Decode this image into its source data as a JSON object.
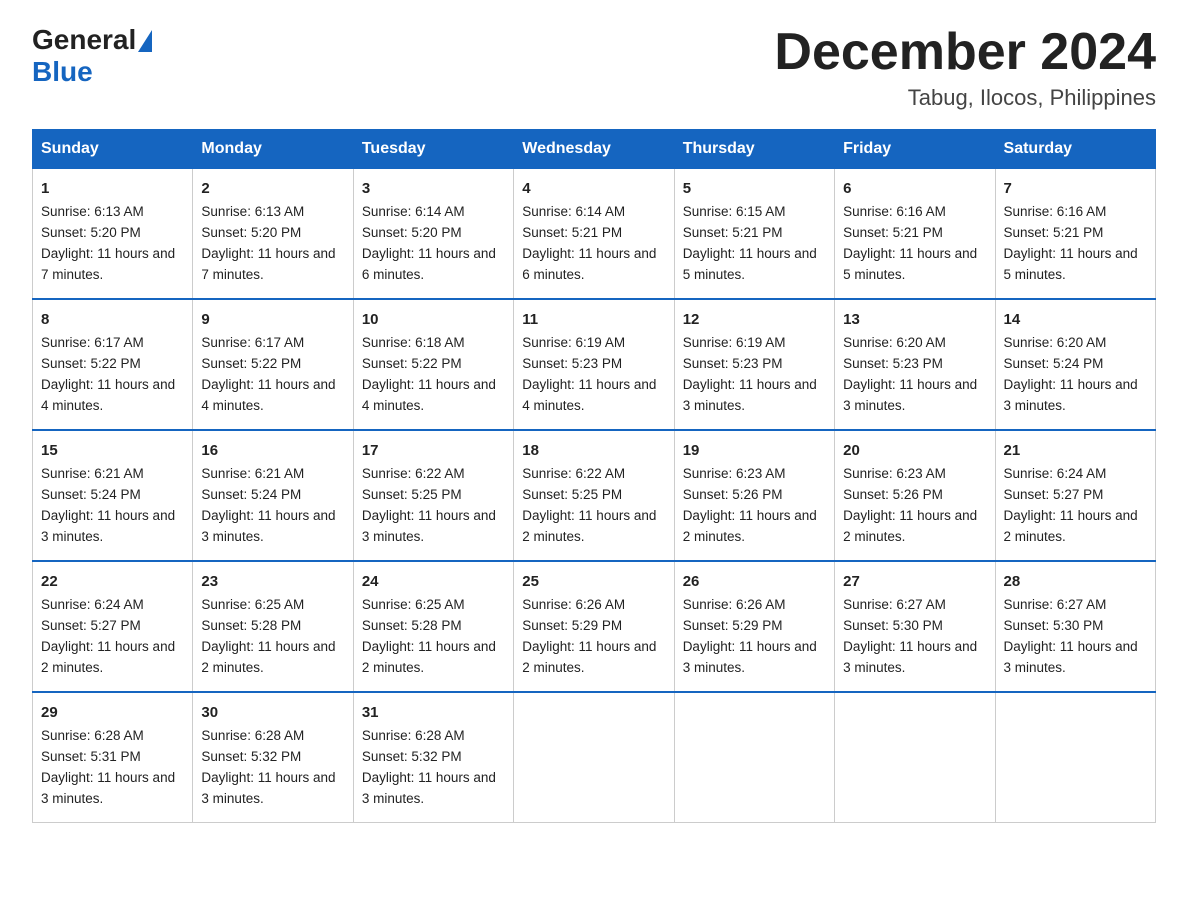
{
  "logo": {
    "general": "General",
    "blue": "Blue"
  },
  "title": "December 2024",
  "subtitle": "Tabug, Ilocos, Philippines",
  "days": [
    "Sunday",
    "Monday",
    "Tuesday",
    "Wednesday",
    "Thursday",
    "Friday",
    "Saturday"
  ],
  "weeks": [
    [
      {
        "num": "1",
        "sunrise": "6:13 AM",
        "sunset": "5:20 PM",
        "daylight": "11 hours and 7 minutes."
      },
      {
        "num": "2",
        "sunrise": "6:13 AM",
        "sunset": "5:20 PM",
        "daylight": "11 hours and 7 minutes."
      },
      {
        "num": "3",
        "sunrise": "6:14 AM",
        "sunset": "5:20 PM",
        "daylight": "11 hours and 6 minutes."
      },
      {
        "num": "4",
        "sunrise": "6:14 AM",
        "sunset": "5:21 PM",
        "daylight": "11 hours and 6 minutes."
      },
      {
        "num": "5",
        "sunrise": "6:15 AM",
        "sunset": "5:21 PM",
        "daylight": "11 hours and 5 minutes."
      },
      {
        "num": "6",
        "sunrise": "6:16 AM",
        "sunset": "5:21 PM",
        "daylight": "11 hours and 5 minutes."
      },
      {
        "num": "7",
        "sunrise": "6:16 AM",
        "sunset": "5:21 PM",
        "daylight": "11 hours and 5 minutes."
      }
    ],
    [
      {
        "num": "8",
        "sunrise": "6:17 AM",
        "sunset": "5:22 PM",
        "daylight": "11 hours and 4 minutes."
      },
      {
        "num": "9",
        "sunrise": "6:17 AM",
        "sunset": "5:22 PM",
        "daylight": "11 hours and 4 minutes."
      },
      {
        "num": "10",
        "sunrise": "6:18 AM",
        "sunset": "5:22 PM",
        "daylight": "11 hours and 4 minutes."
      },
      {
        "num": "11",
        "sunrise": "6:19 AM",
        "sunset": "5:23 PM",
        "daylight": "11 hours and 4 minutes."
      },
      {
        "num": "12",
        "sunrise": "6:19 AM",
        "sunset": "5:23 PM",
        "daylight": "11 hours and 3 minutes."
      },
      {
        "num": "13",
        "sunrise": "6:20 AM",
        "sunset": "5:23 PM",
        "daylight": "11 hours and 3 minutes."
      },
      {
        "num": "14",
        "sunrise": "6:20 AM",
        "sunset": "5:24 PM",
        "daylight": "11 hours and 3 minutes."
      }
    ],
    [
      {
        "num": "15",
        "sunrise": "6:21 AM",
        "sunset": "5:24 PM",
        "daylight": "11 hours and 3 minutes."
      },
      {
        "num": "16",
        "sunrise": "6:21 AM",
        "sunset": "5:24 PM",
        "daylight": "11 hours and 3 minutes."
      },
      {
        "num": "17",
        "sunrise": "6:22 AM",
        "sunset": "5:25 PM",
        "daylight": "11 hours and 3 minutes."
      },
      {
        "num": "18",
        "sunrise": "6:22 AM",
        "sunset": "5:25 PM",
        "daylight": "11 hours and 2 minutes."
      },
      {
        "num": "19",
        "sunrise": "6:23 AM",
        "sunset": "5:26 PM",
        "daylight": "11 hours and 2 minutes."
      },
      {
        "num": "20",
        "sunrise": "6:23 AM",
        "sunset": "5:26 PM",
        "daylight": "11 hours and 2 minutes."
      },
      {
        "num": "21",
        "sunrise": "6:24 AM",
        "sunset": "5:27 PM",
        "daylight": "11 hours and 2 minutes."
      }
    ],
    [
      {
        "num": "22",
        "sunrise": "6:24 AM",
        "sunset": "5:27 PM",
        "daylight": "11 hours and 2 minutes."
      },
      {
        "num": "23",
        "sunrise": "6:25 AM",
        "sunset": "5:28 PM",
        "daylight": "11 hours and 2 minutes."
      },
      {
        "num": "24",
        "sunrise": "6:25 AM",
        "sunset": "5:28 PM",
        "daylight": "11 hours and 2 minutes."
      },
      {
        "num": "25",
        "sunrise": "6:26 AM",
        "sunset": "5:29 PM",
        "daylight": "11 hours and 2 minutes."
      },
      {
        "num": "26",
        "sunrise": "6:26 AM",
        "sunset": "5:29 PM",
        "daylight": "11 hours and 3 minutes."
      },
      {
        "num": "27",
        "sunrise": "6:27 AM",
        "sunset": "5:30 PM",
        "daylight": "11 hours and 3 minutes."
      },
      {
        "num": "28",
        "sunrise": "6:27 AM",
        "sunset": "5:30 PM",
        "daylight": "11 hours and 3 minutes."
      }
    ],
    [
      {
        "num": "29",
        "sunrise": "6:28 AM",
        "sunset": "5:31 PM",
        "daylight": "11 hours and 3 minutes."
      },
      {
        "num": "30",
        "sunrise": "6:28 AM",
        "sunset": "5:32 PM",
        "daylight": "11 hours and 3 minutes."
      },
      {
        "num": "31",
        "sunrise": "6:28 AM",
        "sunset": "5:32 PM",
        "daylight": "11 hours and 3 minutes."
      },
      null,
      null,
      null,
      null
    ]
  ],
  "labels": {
    "sunrise": "Sunrise:",
    "sunset": "Sunset:",
    "daylight": "Daylight:"
  }
}
